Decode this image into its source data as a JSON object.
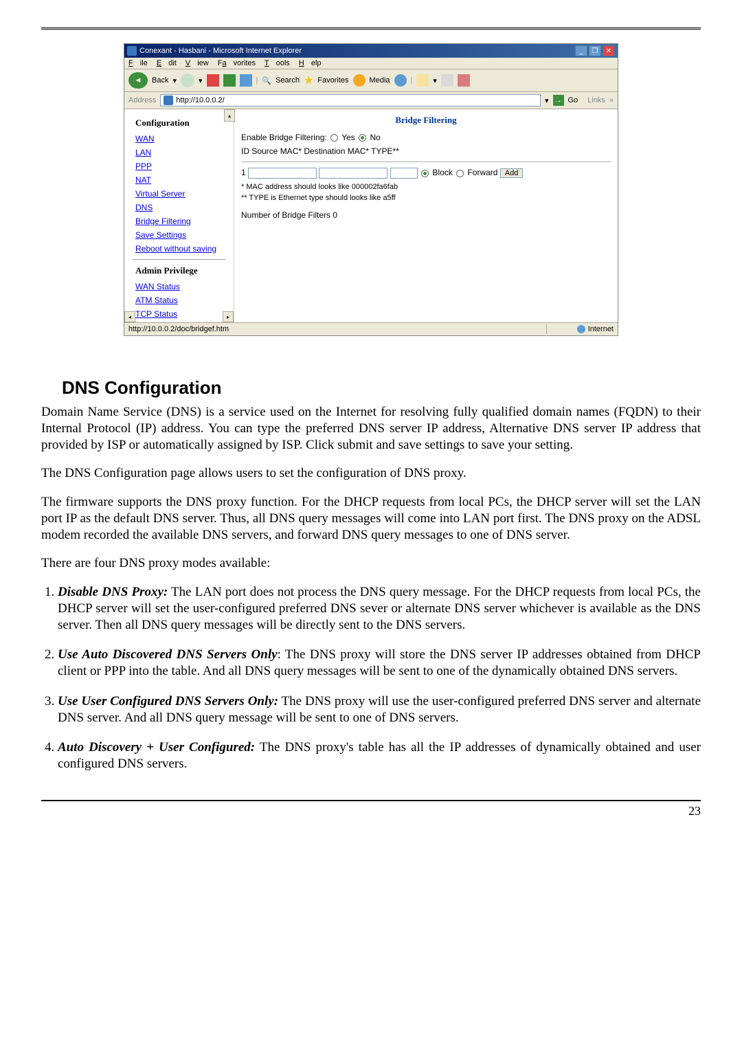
{
  "screenshot": {
    "title": "Conexant - Hasbani - Microsoft Internet Explorer",
    "menu": {
      "file": "File",
      "edit": "Edit",
      "view": "View",
      "favorites": "Favorites",
      "tools": "Tools",
      "help": "Help"
    },
    "toolbar": {
      "back": "Back",
      "search": "Search",
      "favorites": "Favorites",
      "media": "Media"
    },
    "addressbar": {
      "label": "Address",
      "url": "http://10.0.0.2/",
      "go": "Go",
      "links": "Links"
    },
    "sidebar": {
      "config_heading": "Configuration",
      "items": [
        "WAN",
        "LAN",
        "PPP",
        "NAT",
        "Virtual Server",
        "DNS",
        "Bridge Filtering",
        "Save Settings",
        "Reboot without saving"
      ],
      "admin_heading": "Admin Privilege",
      "admin_items": [
        "WAN Status",
        "ATM Status",
        "TCP Status"
      ]
    },
    "main": {
      "heading": "Bridge Filtering",
      "enable_label": "Enable Bridge Filtering:",
      "yes": "Yes",
      "no": "No",
      "cols": "ID Source MAC*  Destination MAC* TYPE**",
      "row_id": "1",
      "block": "Block",
      "forward": "Forward",
      "add": "Add",
      "note1": "* MAC address should looks like 000002fa6fab",
      "note2": "** TYPE is Ethernet type should looks like a5ff",
      "count": "Number of Bridge Filters 0"
    },
    "status": {
      "left": "http://10.0.0.2/doc/bridgef.htm",
      "right": "Internet"
    }
  },
  "doc": {
    "title": "DNS Configuration",
    "p1": "Domain Name Service (DNS) is a service used on the Internet for resolving fully qualified domain names (FQDN) to their Internal Protocol (IP) address. You can type the preferred DNS server IP address, Alternative DNS server IP address that provided by ISP or automatically assigned by ISP. Click submit and save settings to save your setting.",
    "p2": "The DNS Configuration page allows users to set the configuration of DNS proxy.",
    "p3": "The firmware supports the DNS proxy function. For the DHCP requests from local PCs, the DHCP server will set the LAN port IP as the default DNS server. Thus, all DNS query messages will come into LAN port first. The DNS proxy on the ADSL modem recorded the available DNS servers, and forward DNS query messages to one of DNS server.",
    "p4": "There are four DNS proxy modes available:",
    "li1_title": "Disable DNS Proxy:",
    "li1_text": " The LAN port does not process the DNS query message. For the DHCP requests from local PCs, the DHCP server will set the user-configured preferred DNS sever or alternate DNS server whichever is available as the DNS server. Then all DNS query messages will be directly sent to the DNS servers.",
    "li2_title": "Use Auto Discovered DNS Servers Only",
    "li2_text": ": The DNS proxy will store the DNS server IP addresses obtained from DHCP client or PPP into the table. And all DNS query messages will be sent to one of the dynamically obtained DNS servers.",
    "li3_title": "Use User Configured DNS Servers Only:",
    "li3_text": " The DNS proxy will use the user-configured preferred DNS server and alternate DNS server. And all DNS query message will be sent to one of DNS servers.",
    "li4_title": "Auto Discovery + User Configured:",
    "li4_text": " The DNS proxy's table has all the IP addresses of dynamically obtained and user configured DNS servers.",
    "page_no": "23"
  }
}
